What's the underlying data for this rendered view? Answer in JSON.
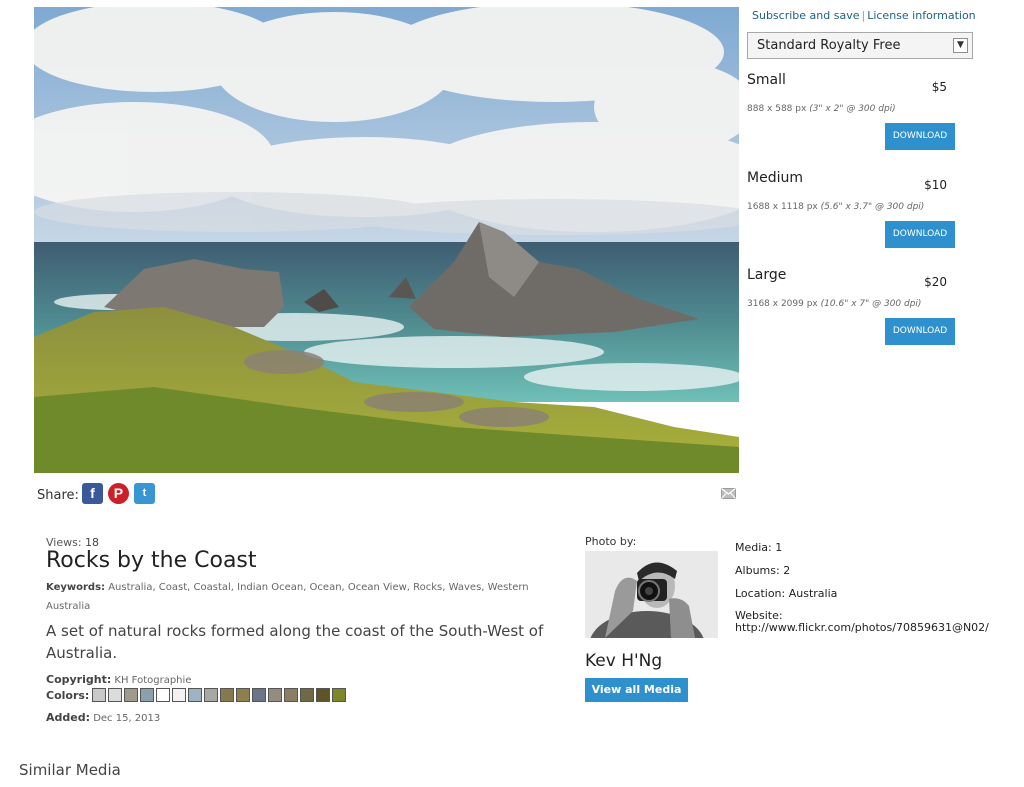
{
  "header_links": {
    "subscribe": "Subscribe and save",
    "separator": "|",
    "license_info": "License information"
  },
  "license": {
    "selected": "Standard Royalty Free"
  },
  "sizes": [
    {
      "name": "Small",
      "price": "$5",
      "pixels": "888 x 588 px",
      "print": "(3\" x 2\" @ 300 dpi)",
      "button": "DOWNLOAD"
    },
    {
      "name": "Medium",
      "price": "$10",
      "pixels": "1688 x 1118 px",
      "print": "(5.6\" x 3.7\" @ 300 dpi)",
      "button": "DOWNLOAD"
    },
    {
      "name": "Large",
      "price": "$20",
      "pixels": "3168 x 2099 px",
      "print": "(10.6\" x 7\" @ 300 dpi)",
      "button": "DOWNLOAD"
    }
  ],
  "share": {
    "label": "Share:",
    "icons": [
      "facebook-icon",
      "pinterest-icon",
      "twitter-icon",
      "email-icon"
    ]
  },
  "media": {
    "views_label": "Views:",
    "views": "18",
    "title": "Rocks by the Coast",
    "keywords_label": "Keywords:",
    "keywords": "Australia, Coast, Coastal, Indian Ocean, Ocean, Ocean View, Rocks, Waves, Western Australia",
    "description": "A set of natural rocks formed along the coast of the South-West of Australia.",
    "copyright_label": "Copyright:",
    "copyright": "KH Fotographie",
    "colors_label": "Colors:",
    "colors": [
      "#c9c9c9",
      "#dcdcdc",
      "#a09a8c",
      "#8aa1ad",
      "#ffffff",
      "#f2f2f2",
      "#9db2c3",
      "#a9a7a2",
      "#857a4d",
      "#8d7f50",
      "#6a7588",
      "#948d7f",
      "#8c7f61",
      "#6f6a45",
      "#5f5328",
      "#7e8629"
    ],
    "added_label": "Added:",
    "added": "Dec 15, 2013"
  },
  "author": {
    "photo_by": "Photo by:",
    "name": "Kev H'Ng",
    "view_all": "View all Media",
    "media_label": "Media:",
    "media": "1",
    "albums_label": "Albums:",
    "albums": "2",
    "location_label": "Location:",
    "location": "Australia",
    "website_label": "Website:",
    "website": "http://www.flickr.com/photos/70859631@N02/"
  },
  "similar": "Similar Media"
}
